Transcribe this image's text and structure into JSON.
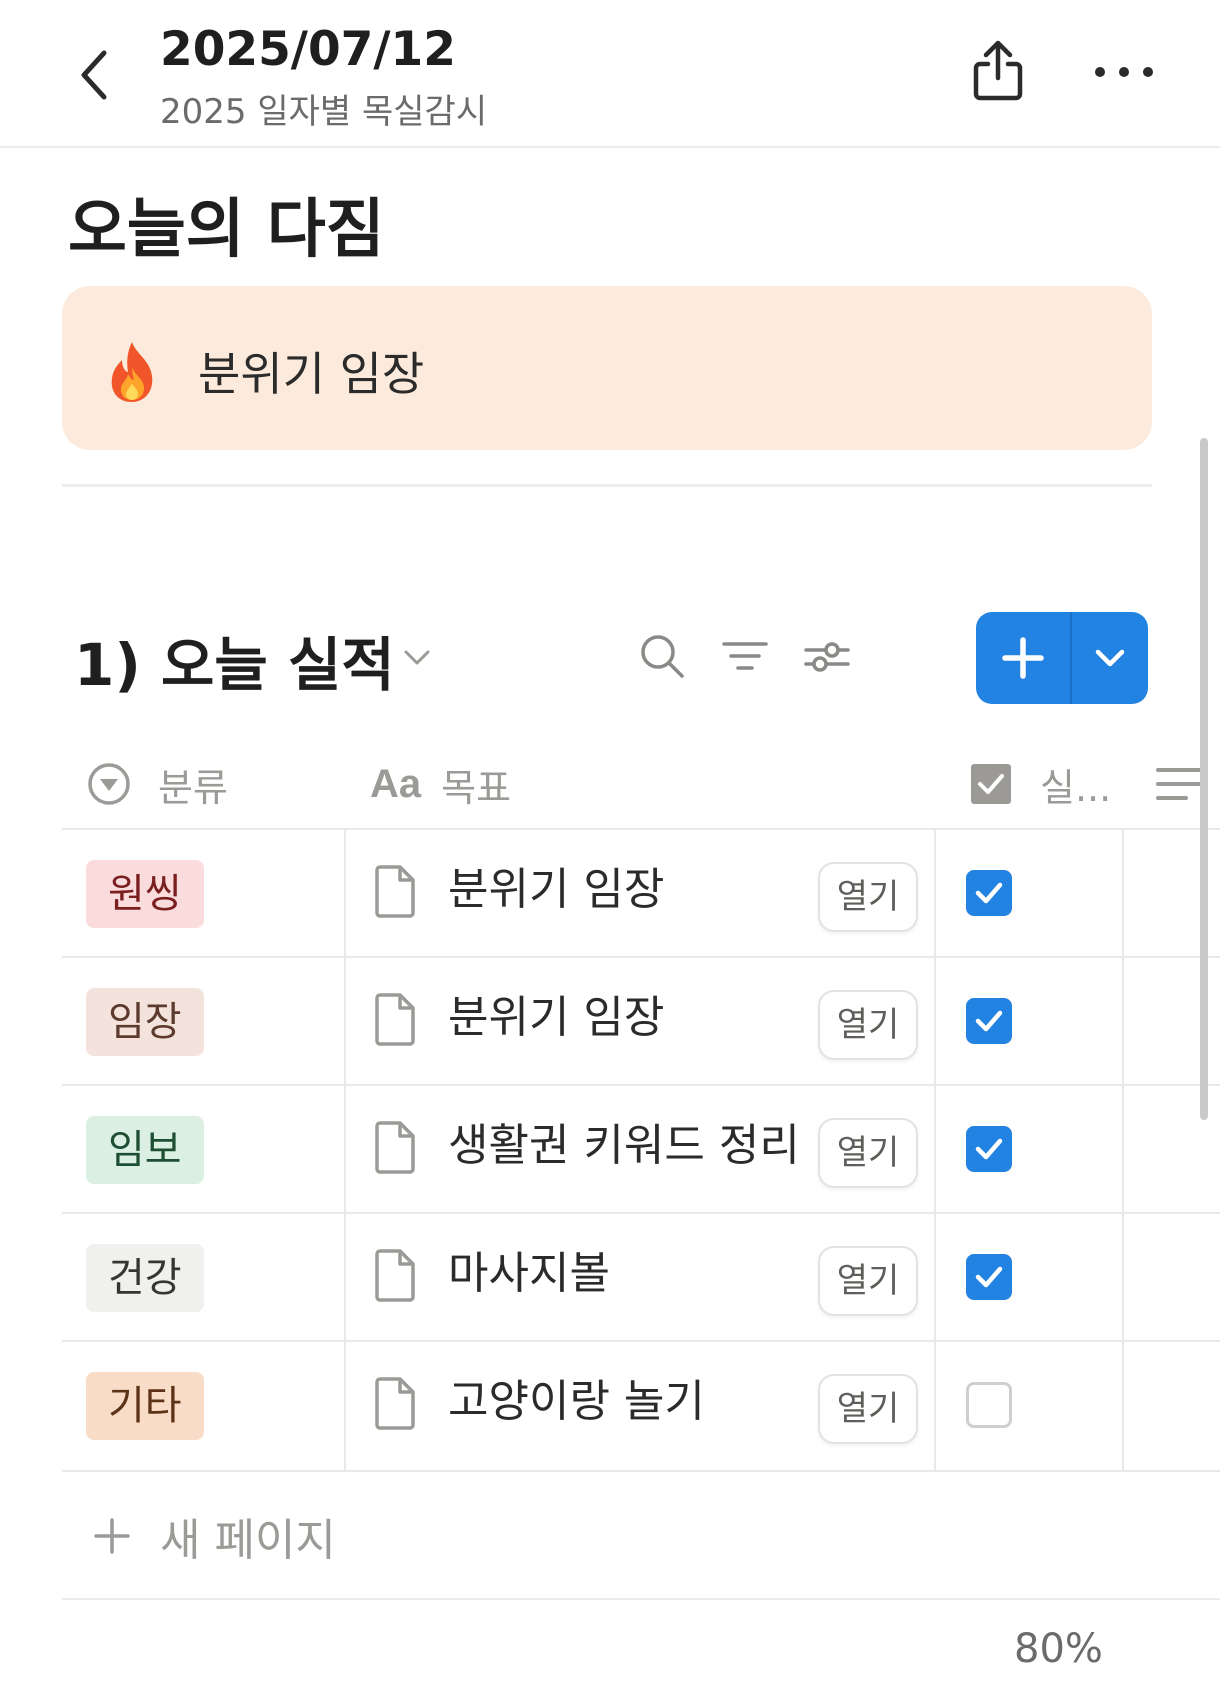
{
  "topbar": {
    "date": "2025/07/12",
    "subtitle": "2025 일자별 목실감시"
  },
  "heading": "오늘의 다짐",
  "callout": {
    "icon": "fire-emoji",
    "text": "분위기 임장"
  },
  "database": {
    "title": "1) 오늘 실적",
    "columns": {
      "category": "분류",
      "goal": "목표",
      "done": "실..."
    },
    "open_label": "열기",
    "rows": [
      {
        "category": "원씽",
        "tag_bg": "#fbdcdc",
        "tag_fg": "#7a1f1f",
        "goal": "분위기 임장",
        "checked": true
      },
      {
        "category": "임장",
        "tag_bg": "#f4e3dc",
        "tag_fg": "#5c3b2e",
        "goal": "분위기 임장",
        "checked": true
      },
      {
        "category": "임보",
        "tag_bg": "#dcefe3",
        "tag_fg": "#1f4f33",
        "goal": "생활권 키워드 정리",
        "checked": true
      },
      {
        "category": "건강",
        "tag_bg": "#f0f0ef",
        "tag_fg": "#37352f",
        "goal": "마사지볼",
        "checked": true
      },
      {
        "category": "기타",
        "tag_bg": "#f9dcc8",
        "tag_fg": "#5c3317",
        "goal": "고양이랑 놀기",
        "checked": false
      }
    ],
    "new_page_label": "새 페이지",
    "percent": "80%"
  },
  "colors": {
    "accent": "#2383e2",
    "callout_bg": "#fcebdc"
  }
}
